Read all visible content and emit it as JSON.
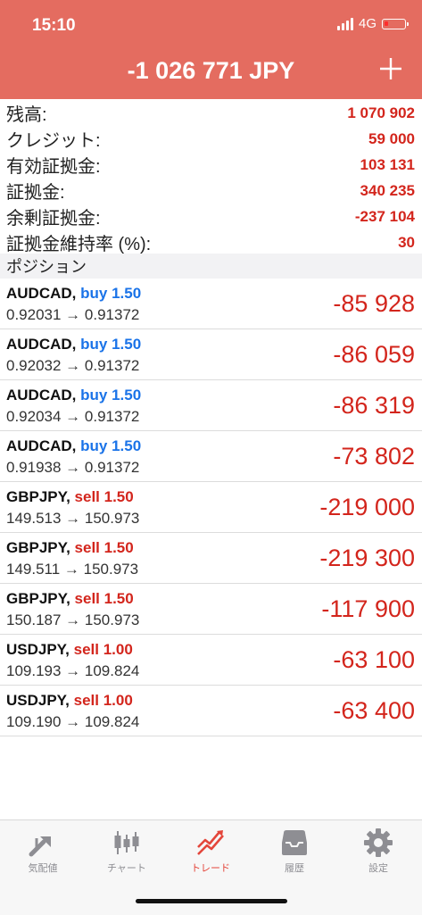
{
  "status_bar": {
    "time": "15:10",
    "network": "4G"
  },
  "header": {
    "title": "-1 026 771 JPY"
  },
  "summary": [
    {
      "label": "残高:",
      "value": "1 070 902"
    },
    {
      "label": "クレジット:",
      "value": "59 000"
    },
    {
      "label": "有効証拠金:",
      "value": "103 131"
    },
    {
      "label": "証拠金:",
      "value": "340 235"
    },
    {
      "label": "余剰証拠金:",
      "value": "-237 104"
    },
    {
      "label": "証拠金維持率 (%):",
      "value": "30"
    }
  ],
  "section_title": "ポジション",
  "positions": [
    {
      "symbol": "AUDCAD,",
      "side": "buy 1.50",
      "prices": "0.92031 → 0.91372",
      "profit": "-85 928"
    },
    {
      "symbol": "AUDCAD,",
      "side": "buy 1.50",
      "prices": "0.92032 → 0.91372",
      "profit": "-86 059"
    },
    {
      "symbol": "AUDCAD,",
      "side": "buy 1.50",
      "prices": "0.92034 → 0.91372",
      "profit": "-86 319"
    },
    {
      "symbol": "AUDCAD,",
      "side": "buy 1.50",
      "prices": "0.91938 → 0.91372",
      "profit": "-73 802"
    },
    {
      "symbol": "GBPJPY,",
      "side": "sell 1.50",
      "prices": "149.513 → 150.973",
      "profit": "-219 000"
    },
    {
      "symbol": "GBPJPY,",
      "side": "sell 1.50",
      "prices": "149.511 → 150.973",
      "profit": "-219 300"
    },
    {
      "symbol": "GBPJPY,",
      "side": "sell 1.50",
      "prices": "150.187 → 150.973",
      "profit": "-117 900"
    },
    {
      "symbol": "USDJPY,",
      "side": "sell 1.00",
      "prices": "109.193 → 109.824",
      "profit": "-63 100"
    },
    {
      "symbol": "USDJPY,",
      "side": "sell 1.00",
      "prices": "109.190 → 109.824",
      "profit": "-63 400"
    }
  ],
  "tabs": [
    {
      "label": "気配値",
      "icon": "quotes-icon"
    },
    {
      "label": "チャート",
      "icon": "chart-icon"
    },
    {
      "label": "トレード",
      "icon": "trade-icon"
    },
    {
      "label": "履歴",
      "icon": "history-icon"
    },
    {
      "label": "設定",
      "icon": "settings-icon"
    }
  ],
  "colors": {
    "header": "#e46c60",
    "negative": "#d3251c",
    "buy": "#1a73e8",
    "sell": "#d3251c",
    "active_tab": "#e4463b"
  }
}
